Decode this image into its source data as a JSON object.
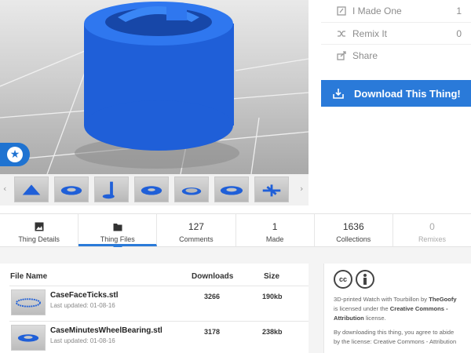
{
  "actions": {
    "made_one": {
      "label": "I Made One",
      "count": "1",
      "icon": "edit-icon"
    },
    "remix": {
      "label": "Remix It",
      "count": "0",
      "icon": "shuffle-icon"
    },
    "share": {
      "label": "Share",
      "icon": "share-icon"
    }
  },
  "download_button": {
    "label": "Download This Thing!",
    "icon": "download-icon"
  },
  "tabs": [
    {
      "id": "details",
      "label": "Thing Details",
      "icon": "photo-icon"
    },
    {
      "id": "files",
      "label": "Thing Files",
      "icon": "folder-icon",
      "active": true
    },
    {
      "id": "comments",
      "count": "127",
      "label": "Comments"
    },
    {
      "id": "made",
      "count": "1",
      "label": "Made"
    },
    {
      "id": "collections",
      "count": "1636",
      "label": "Collections"
    },
    {
      "id": "remixes",
      "count": "0",
      "label": "Remixes"
    }
  ],
  "files_table": {
    "headers": {
      "name": "File Name",
      "downloads": "Downloads",
      "size": "Size"
    },
    "rows": [
      {
        "name": "CaseFaceTicks.stl",
        "updated": "Last updated: 01-08-16",
        "downloads": "3266",
        "size": "190kb"
      },
      {
        "name": "CaseMinutesWheelBearing.stl",
        "updated": "Last updated: 01-08-16",
        "downloads": "3178",
        "size": "238kb"
      }
    ]
  },
  "license": {
    "icons": [
      "cc-icon",
      "person-icon"
    ],
    "line1_title": "3D-printed Watch with Tourbillon",
    "line1_by": "by",
    "line1_author": "TheGoofy",
    "line1_is": "is licensed under the",
    "line1_license": "Creative Commons - Attribution",
    "line1_end": "license.",
    "line2": "By downloading this thing, you agree to abide by the license: Creative Commons - Attribution"
  },
  "colors": {
    "accent": "#2a7ad9",
    "model": "#1a5fdb"
  }
}
